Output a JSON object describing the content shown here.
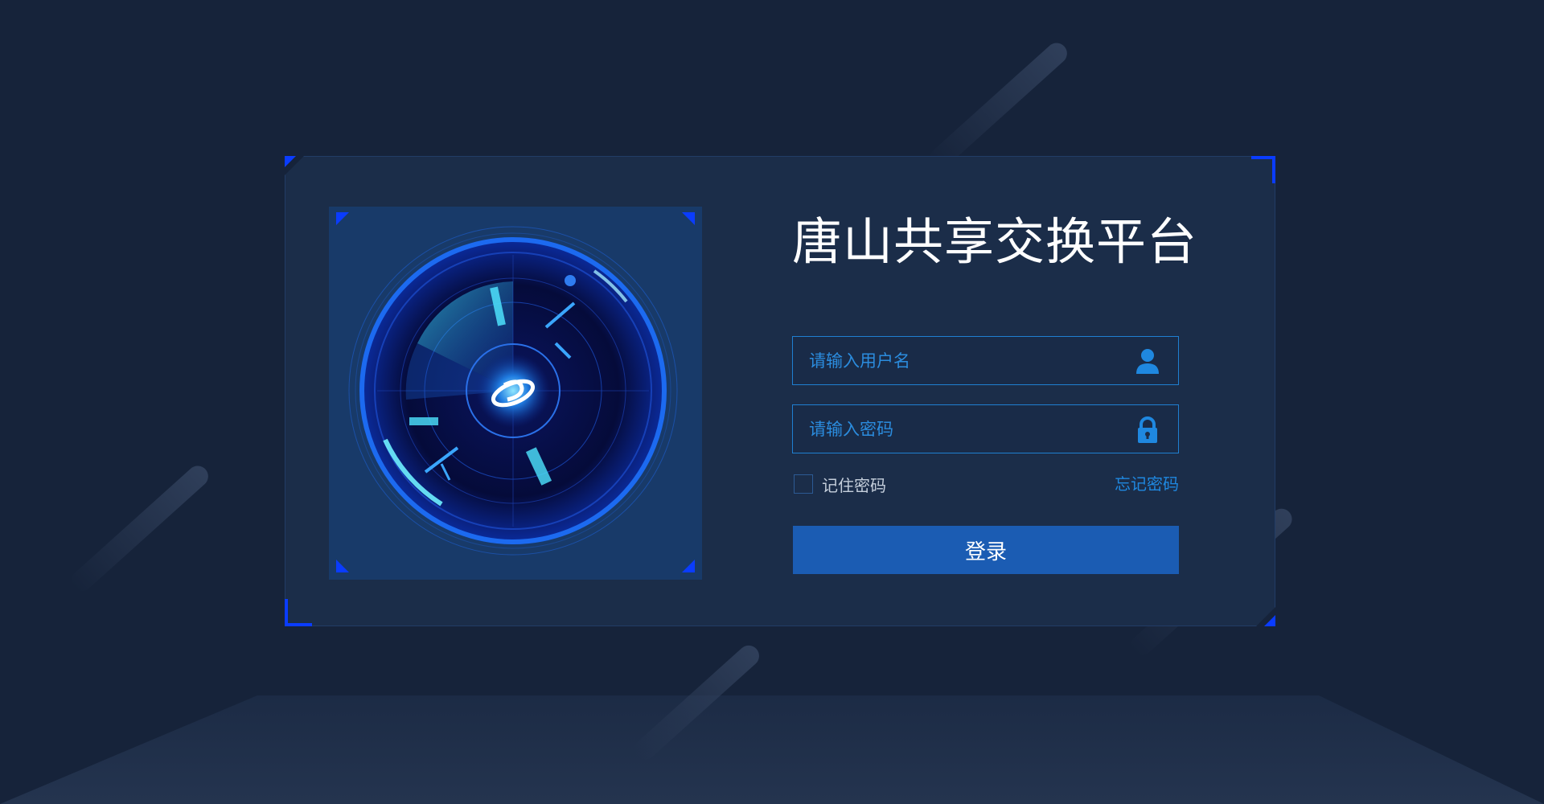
{
  "app": {
    "title": "唐山共享交换平台"
  },
  "login_form": {
    "username": {
      "value": "",
      "placeholder": "请输入用户名",
      "icon": "user-icon"
    },
    "password": {
      "value": "",
      "placeholder": "请输入密码",
      "icon": "lock-icon"
    },
    "remember_label": "记住密码",
    "remember_checked": false,
    "forgot_label": "忘记密码",
    "submit_label": "登录"
  },
  "colors": {
    "background": "#16233a",
    "card": "#1b2d49",
    "accent": "#1f88e0",
    "corner_accent": "#0a3cff",
    "button": "#1b5cb3"
  },
  "illustration": {
    "icon": "radar-globe-logo-icon"
  }
}
